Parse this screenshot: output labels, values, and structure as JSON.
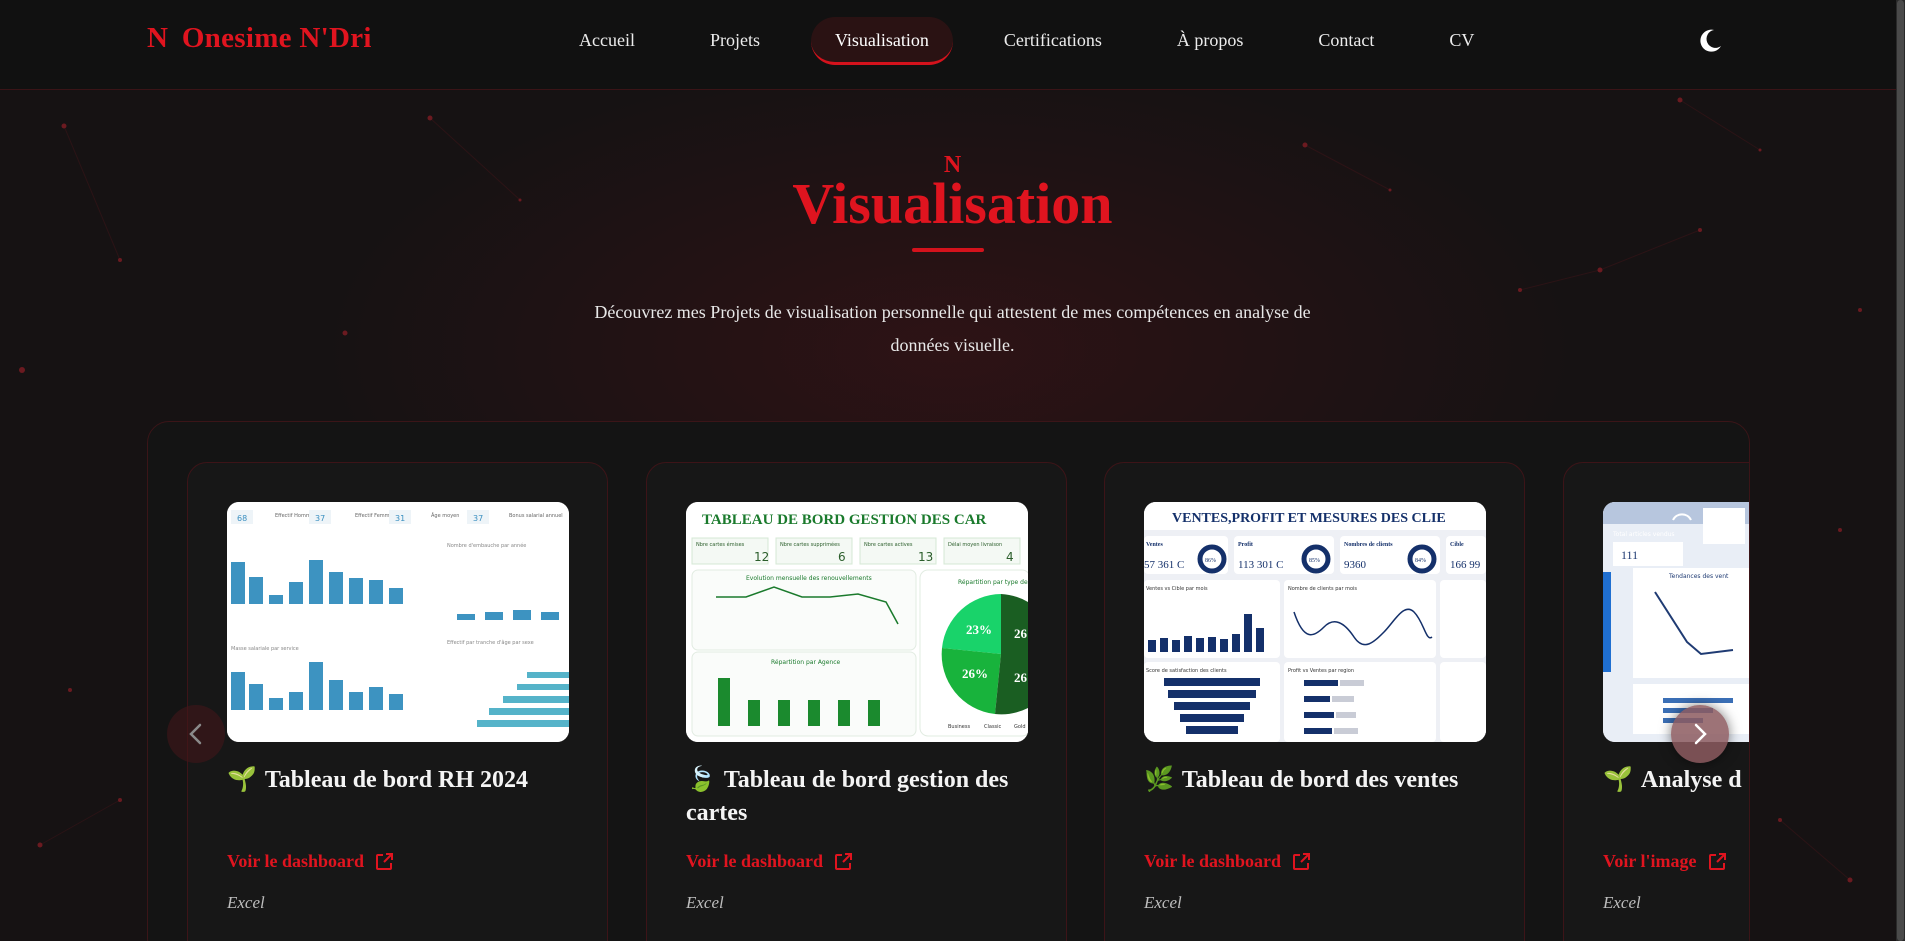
{
  "brand": {
    "mark": "N",
    "name": "Onesime N'Dri",
    "color": "#e0141f"
  },
  "nav": {
    "items": [
      {
        "label": "Accueil",
        "active": false
      },
      {
        "label": "Projets",
        "active": false
      },
      {
        "label": "Visualisation",
        "active": true
      },
      {
        "label": "Certifications",
        "active": false
      },
      {
        "label": "À propos",
        "active": false
      },
      {
        "label": "Contact",
        "active": false
      },
      {
        "label": "CV",
        "active": false
      }
    ],
    "theme_toggle_icon": "moon-icon"
  },
  "hero": {
    "mark": "N",
    "title": "Visualisation",
    "description": "Découvrez mes Projets de visualisation personnelle qui attestent de mes compétences en analyse de données visuelle."
  },
  "cards": [
    {
      "emoji": "🌱",
      "title": "Tableau de bord RH 2024",
      "link_label": "Voir le dashboard",
      "tool": "Excel",
      "thumb": {
        "kpis": [
          "68",
          "37",
          "31",
          "37"
        ],
        "kpi_labels": [
          "Effectif Hommes",
          "Effectif Femmes",
          "Âge moyen",
          "Bonus salarial annuel"
        ],
        "chart1_label": "Nombre d'embauche par année",
        "chart2_label": "Masse salariale par service",
        "chart3_label": "Effectif par tranche d'âge par sexe"
      }
    },
    {
      "emoji": "🍃",
      "title": "Tableau de bord gestion des cartes",
      "link_label": "Voir le dashboard",
      "tool": "Excel",
      "thumb": {
        "header": "TABLEAU DE BORD GESTION DES CAR",
        "kpis": [
          {
            "label": "Nbre cartes émises",
            "value": "12"
          },
          {
            "label": "Nbre cartes supprimées",
            "value": "6"
          },
          {
            "label": "Nbre cartes actives",
            "value": "13"
          },
          {
            "label": "Délai moyen livraison",
            "value": "4"
          }
        ],
        "line_label": "Evolution mensuelle des renouvellements",
        "bar_label": "Répartition par Agence",
        "pie_label": "Répartition par type de",
        "pie_pcts": [
          "23%",
          "26%",
          "26%",
          "26%"
        ],
        "pie_legend": [
          "Business",
          "Classic",
          "Gold"
        ]
      }
    },
    {
      "emoji": "🌿",
      "title": "Tableau de bord des ventes",
      "link_label": "Voir le dashboard",
      "tool": "Excel",
      "thumb": {
        "header": "VENTES,PROFIT ET MESURES DES CLIE",
        "kpis": [
          {
            "label": "Ventes",
            "value": "57 361 C",
            "pct": "86%"
          },
          {
            "label": "Profit",
            "value": "113 301 C",
            "pct": "85%"
          },
          {
            "label": "Nombres de clients",
            "value": "9360",
            "pct": "84%"
          },
          {
            "label": "Cible",
            "value": "166 99"
          }
        ],
        "chart1_label": "Ventes vs Cible par mois",
        "chart2_label": "Nombre de clients par mois",
        "chart3_label": "Score de satisfaction des clients",
        "chart4_label": "Profit vs Ventes par region"
      }
    },
    {
      "emoji": "🌱",
      "title": "Analyse d",
      "link_label": "Voir l'image",
      "tool": "Excel",
      "thumb": {
        "kpi_label": "Total articles vendus",
        "kpi_value": "111",
        "trend_label": "Tendances des vent"
      }
    }
  ],
  "colors": {
    "accent": "#e0141f",
    "background": "#161213",
    "card": "#171717",
    "card_border": "#3d1418"
  }
}
